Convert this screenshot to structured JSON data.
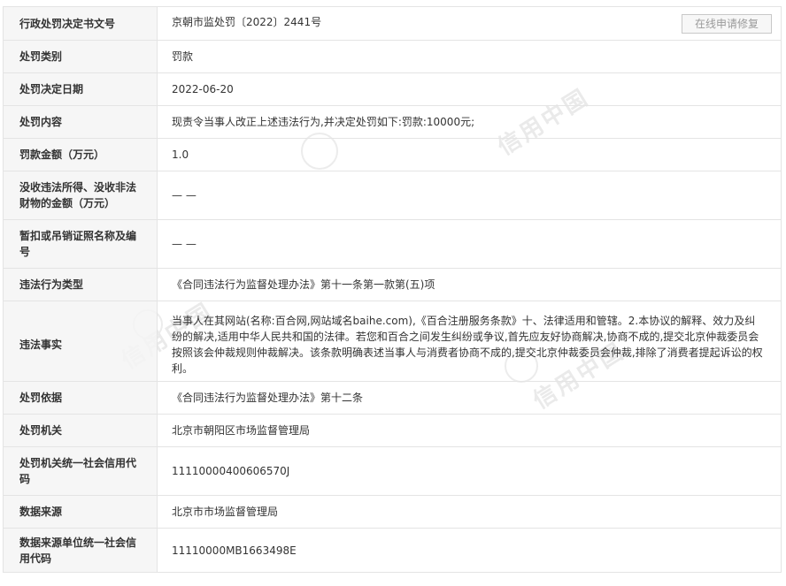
{
  "watermark_text": "信用中国",
  "rows": [
    {
      "label": "行政处罚决定书文号",
      "value": "京朝市监处罚〔2022〕2441号"
    },
    {
      "label": "处罚类别",
      "value": "罚款"
    },
    {
      "label": "处罚决定日期",
      "value": "2022-06-20"
    },
    {
      "label": "处罚内容",
      "value": "现责令当事人改正上述违法行为,并决定处罚如下:罚款:10000元;"
    },
    {
      "label": "罚款金额（万元）",
      "value": "1.0"
    },
    {
      "label": "没收违法所得、没收非法财物的金额（万元）",
      "value": "— —"
    },
    {
      "label": "暂扣或吊销证照名称及编号",
      "value": "— —"
    },
    {
      "label": "违法行为类型",
      "value": "《合同违法行为监督处理办法》第十一条第一款第(五)项"
    },
    {
      "label": "违法事实",
      "value": "当事人在其网站(名称:百合网,网站域名baihe.com),《百合注册服务条款》十、法律适用和管辖。2.本协议的解释、效力及纠纷的解决,适用中华人民共和国的法律。若您和百合之间发生纠纷或争议,首先应友好协商解决,协商不成的,提交北京仲裁委员会按照该会仲裁规则仲裁解决。该条款明确表述当事人与消费者协商不成的,提交北京仲裁委员会仲裁,排除了消费者提起诉讼的权利。"
    },
    {
      "label": "处罚依据",
      "value": "《合同违法行为监督处理办法》第十二条"
    },
    {
      "label": "处罚机关",
      "value": "北京市朝阳区市场监督管理局"
    },
    {
      "label": "处罚机关统一社会信用代码",
      "value": "11110000400606570J"
    },
    {
      "label": "数据来源",
      "value": "北京市市场监督管理局"
    },
    {
      "label": "数据来源单位统一社会信用代码",
      "value": "11110000MB1663498E"
    }
  ],
  "repair_button": "在线申请修复"
}
